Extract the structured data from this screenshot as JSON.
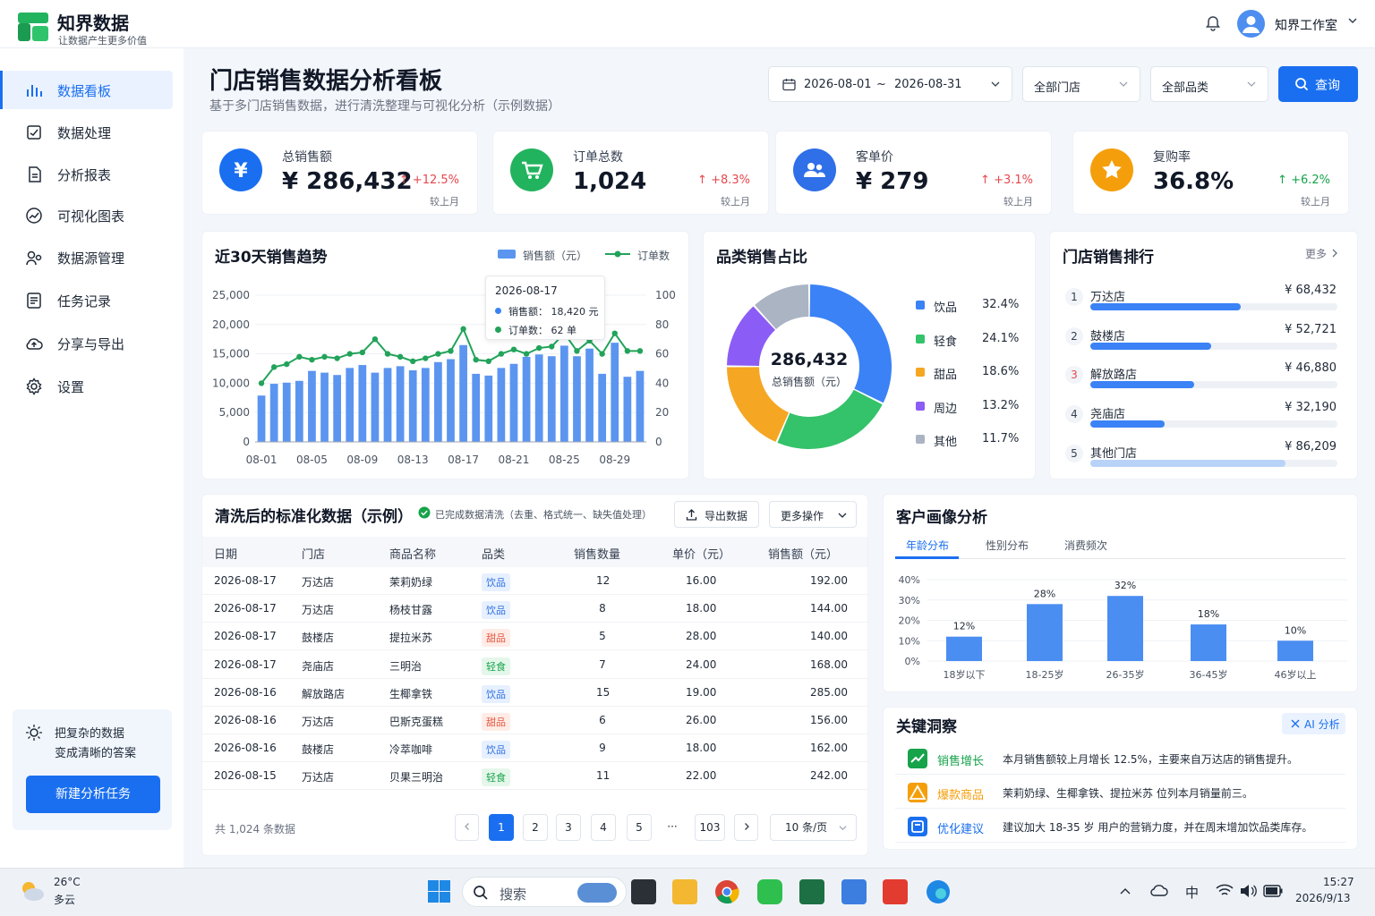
{
  "app": {
    "brand": "知界数据",
    "slogan": "让数据产生更多价值",
    "user": "知界工作室"
  },
  "sidebar": {
    "items": [
      {
        "label": "数据看板",
        "icon": "bar-chart-icon",
        "active": true
      },
      {
        "label": "数据处理",
        "icon": "data-process-icon"
      },
      {
        "label": "分析报表",
        "icon": "report-icon"
      },
      {
        "label": "可视化图表",
        "icon": "chart-trend-icon"
      },
      {
        "label": "数据源管理",
        "icon": "datasource-icon"
      },
      {
        "label": "任务记录",
        "icon": "task-list-icon"
      },
      {
        "label": "分享与导出",
        "icon": "cloud-upload-icon"
      },
      {
        "label": "设置",
        "icon": "gear-icon"
      }
    ],
    "promo_line1": "把复杂的数据",
    "promo_line2": "变成清晰的答案",
    "new_task": "新建分析任务"
  },
  "page": {
    "title": "门店销售数据分析看板",
    "subtitle": "基于多门店销售数据，进行清洗整理与可视化分析（示例数据）"
  },
  "filters": {
    "date_start": "2026-08-01",
    "date_sep": "~",
    "date_end": "2026-08-31",
    "store": "全部门店",
    "category": "全部品类",
    "query": "查询"
  },
  "kpis": [
    {
      "label": "总销售额",
      "value": "¥ 286,432",
      "delta": "↑ +12.5%",
      "sub": "较上月",
      "color": "#1a6ff0",
      "icon": "yen-icon"
    },
    {
      "label": "订单总数",
      "value": "1,024",
      "delta": "↑ +8.3%",
      "sub": "较上月",
      "color": "#22b35e",
      "icon": "cart-icon"
    },
    {
      "label": "客单价",
      "value": "¥ 279",
      "delta": "↑ +3.1%",
      "sub": "较上月",
      "color": "#2f6fe8",
      "icon": "users-icon"
    },
    {
      "label": "复购率",
      "value": "36.8%",
      "delta": "↑ +6.2%",
      "sub": "较上月",
      "color": "#f59e0b",
      "icon": "star-icon"
    }
  ],
  "trend": {
    "title": "近30天销售趋势",
    "legend_bar": "销售额（元）",
    "legend_line": "订单数",
    "tooltip": {
      "date": "2026-08-17",
      "sales_label": "销售额：",
      "sales_value": "18,420 元",
      "orders_label": "订单数：",
      "orders_value": "62 单"
    },
    "chart_data": {
      "type": "bar",
      "x_ticks": [
        "08-01",
        "08-05",
        "08-09",
        "08-13",
        "08-17",
        "08-21",
        "08-25",
        "08-29"
      ],
      "y_ticks": [
        "0",
        "5,000",
        "10,000",
        "15,000",
        "20,000",
        "25,000"
      ],
      "y2_ticks": [
        "0",
        "20",
        "40",
        "60",
        "80",
        "100"
      ],
      "ylim": [
        0,
        25000
      ],
      "y2lim": [
        0,
        100
      ],
      "colors": {
        "bar": "#5b95f0",
        "line": "#22a35a"
      },
      "series": [
        {
          "name": "销售额（元）",
          "kind": "bar",
          "values": [
            7900,
            9900,
            10100,
            10400,
            12100,
            11800,
            11400,
            12600,
            13100,
            11800,
            12600,
            12900,
            12200,
            12600,
            13600,
            14100,
            16500,
            11600,
            11300,
            12600,
            13300,
            14500,
            14900,
            14600,
            16400,
            14600,
            15900,
            11600,
            16900,
            11100,
            12100
          ]
        },
        {
          "name": "订单数",
          "kind": "line",
          "values": [
            40,
            51,
            53,
            58,
            56,
            58,
            57,
            60,
            61,
            70,
            60,
            58,
            55,
            57,
            60,
            62,
            77,
            56,
            55,
            60,
            63,
            60,
            64,
            65,
            74,
            62,
            69,
            60,
            74,
            62,
            62
          ]
        }
      ]
    }
  },
  "category": {
    "title": "品类销售占比",
    "center_value": "286,432",
    "center_label": "总销售额（元）",
    "chart_data": {
      "type": "pie",
      "labels": [
        "饮品",
        "轻食",
        "甜品",
        "周边",
        "其他"
      ],
      "values": [
        32.4,
        24.1,
        18.6,
        13.2,
        11.7
      ],
      "display": [
        "32.4%",
        "24.1%",
        "18.6%",
        "13.2%",
        "11.7%"
      ],
      "colors": [
        "#3b82f6",
        "#34c26a",
        "#f5a623",
        "#8b5cf6",
        "#aab4c3"
      ]
    }
  },
  "ranking": {
    "title": "门店销售排行",
    "more": "更多",
    "items": [
      {
        "rank": "1",
        "name": "万达店",
        "value": "¥ 68,432",
        "pct": 0.61,
        "color": "#3b82f6"
      },
      {
        "rank": "2",
        "name": "鼓楼店",
        "value": "¥ 52,721",
        "pct": 0.49,
        "color": "#3b82f6"
      },
      {
        "rank": "3",
        "name": "解放路店",
        "value": "¥ 46,880",
        "pct": 0.42,
        "color": "#3b82f6"
      },
      {
        "rank": "4",
        "name": "尧庙店",
        "value": "¥ 32,190",
        "pct": 0.3,
        "color": "#3b82f6"
      },
      {
        "rank": "5",
        "name": "其他门店",
        "value": "¥ 86,209",
        "pct": 0.79,
        "color": "#b9d3f8"
      }
    ]
  },
  "table": {
    "title": "清洗后的标准化数据（示例）",
    "status": "已完成数据清洗（去重、格式统一、缺失值处理）",
    "export": "导出数据",
    "more_ops": "更多操作",
    "headers": [
      "日期",
      "门店",
      "商品名称",
      "品类",
      "销售数量",
      "单价（元）",
      "销售额（元）"
    ],
    "rows": [
      [
        "2026-08-17",
        "万达店",
        "茉莉奶绿",
        "饮品",
        "12",
        "16.00",
        "192.00"
      ],
      [
        "2026-08-17",
        "万达店",
        "杨枝甘露",
        "饮品",
        "8",
        "18.00",
        "144.00"
      ],
      [
        "2026-08-17",
        "鼓楼店",
        "提拉米苏",
        "甜品",
        "5",
        "28.00",
        "140.00"
      ],
      [
        "2026-08-17",
        "尧庙店",
        "三明治",
        "轻食",
        "7",
        "24.00",
        "168.00"
      ],
      [
        "2026-08-16",
        "解放路店",
        "生椰拿铁",
        "饮品",
        "15",
        "19.00",
        "285.00"
      ],
      [
        "2026-08-16",
        "万达店",
        "巴斯克蛋糕",
        "甜品",
        "6",
        "26.00",
        "156.00"
      ],
      [
        "2026-08-16",
        "鼓楼店",
        "冷萃咖啡",
        "饮品",
        "9",
        "18.00",
        "162.00"
      ],
      [
        "2026-08-15",
        "万达店",
        "贝果三明治",
        "轻食",
        "11",
        "22.00",
        "242.00"
      ]
    ],
    "total": "共 1,024 条数据",
    "pages": [
      "1",
      "2",
      "3",
      "4",
      "5",
      "···",
      "103"
    ],
    "page_size": "10 条/页"
  },
  "customer": {
    "title": "客户画像分析",
    "tabs": [
      "年龄分布",
      "性别分布",
      "消费频次"
    ],
    "chart_data": {
      "type": "bar",
      "categories": [
        "18岁以下",
        "18-25岁",
        "26-35岁",
        "36-45岁",
        "46岁以上"
      ],
      "values": [
        12,
        28,
        32,
        18,
        10
      ],
      "labels": [
        "12%",
        "28%",
        "32%",
        "18%",
        "10%"
      ],
      "y_ticks": [
        "0%",
        "10%",
        "20%",
        "30%",
        "40%"
      ],
      "ylim": [
        0,
        40
      ],
      "color": "#4b8ef2"
    }
  },
  "insights": {
    "title": "关键洞察",
    "ai": "AI 分析",
    "items": [
      {
        "label": "销售增长",
        "text": "本月销售额较上月增长 12.5%，主要来自万达店的销售提升。",
        "color": "#16a34a"
      },
      {
        "label": "爆款商品",
        "text": "茉莉奶绿、生椰拿铁、提拉米苏 位列本月销量前三。",
        "color": "#f59e0b"
      },
      {
        "label": "优化建议",
        "text": "建议加大 18-35 岁 用户的营销力度，并在周末增加饮品类库存。",
        "color": "#1a6ff0"
      }
    ]
  },
  "taskbar": {
    "temp": "26°C",
    "weather": "多云",
    "search": "搜索",
    "ime": "中",
    "time": "15:27",
    "date": "2026/9/13"
  }
}
